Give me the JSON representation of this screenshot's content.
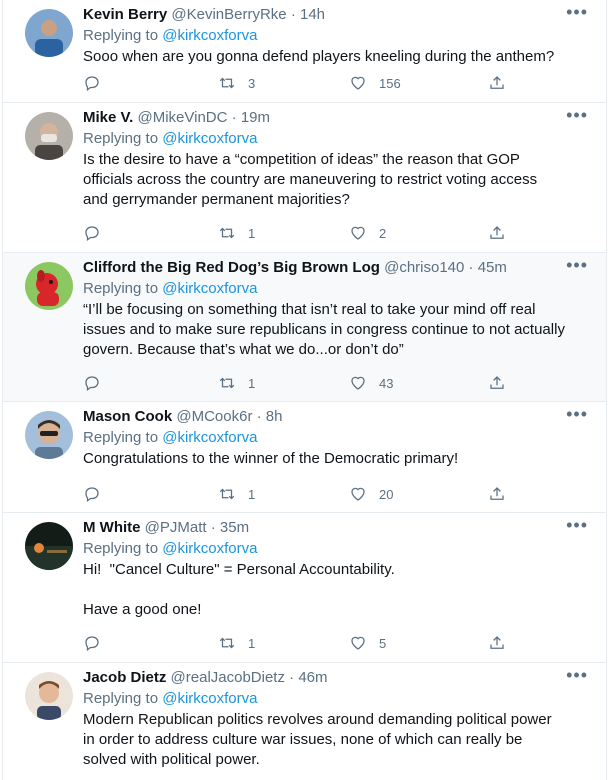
{
  "tweets": [
    {
      "name": "Kevin Berry",
      "handle": "@KevinBerryRke",
      "sep": "·",
      "time": "14h",
      "replying_prefix": "Replying to ",
      "replying_to": "@kirkcoxforva",
      "text": "Sooo when are you gonna defend players kneeling during the anthem?",
      "retweets": "3",
      "likes": "156",
      "avatar_colors": [
        "#6a8fb8",
        "#2c5d8f"
      ],
      "highlighted": false
    },
    {
      "name": "Mike V.",
      "handle": "@MikeVinDC",
      "sep": "·",
      "time": "19m",
      "replying_prefix": "Replying to ",
      "replying_to": "@kirkcoxforva",
      "text": "Is the desire to have a “competition of ideas” the reason that GOP officials across the country are maneuvering to restrict voting access and gerrymander permanent majorities?",
      "retweets": "1",
      "likes": "2",
      "avatar_colors": [
        "#b9b4ad",
        "#5c5650"
      ],
      "highlighted": false
    },
    {
      "name": "Clifford the Big Red Dog’s Big Brown Log",
      "handle": "@chriso140",
      "sep": "·",
      "time": "45m",
      "replying_prefix": "Replying to ",
      "replying_to": "@kirkcoxforva",
      "text": "“I’ll be focusing on something that isn’t real to take your mind off real issues and to make sure republicans in congress continue to not actually govern. Because that’s what we do...or don’t do”",
      "retweets": "1",
      "likes": "43",
      "avatar_colors": [
        "#7fc25a",
        "#d8262a"
      ],
      "highlighted": true
    },
    {
      "name": "Mason Cook",
      "handle": "@MCook6r",
      "sep": "·",
      "time": "8h",
      "replying_prefix": "Replying to ",
      "replying_to": "@kirkcoxforva",
      "text": "Congratulations to the winner of the Democratic primary!",
      "retweets": "1",
      "likes": "20",
      "avatar_colors": [
        "#9cb7d3",
        "#3b3128"
      ],
      "highlighted": false
    },
    {
      "name": "M White",
      "handle": "@PJMatt",
      "sep": "·",
      "time": "35m",
      "replying_prefix": "Replying to ",
      "replying_to": "@kirkcoxforva",
      "text": "Hi!  \"Cancel Culture\" = Personal Accountability.\n\nHave a good one!",
      "retweets": "1",
      "likes": "5",
      "avatar_colors": [
        "#1c2a22",
        "#c8783a"
      ],
      "highlighted": false
    },
    {
      "name": "Jacob Dietz",
      "handle": "@realJacobDietz",
      "sep": "·",
      "time": "46m",
      "replying_prefix": "Replying to ",
      "replying_to": "@kirkcoxforva",
      "text": "Modern Republican politics revolves around demanding political power in order to address culture war issues, none of which can really be solved with political power.",
      "retweets": "",
      "likes": "",
      "avatar_colors": [
        "#e6dcd0",
        "#8a5a3a"
      ],
      "highlighted": false
    }
  ],
  "icons": {
    "more": "more-icon",
    "reply": "reply-icon",
    "retweet": "retweet-icon",
    "like": "heart-icon",
    "share": "share-icon"
  },
  "colors": {
    "link": "#1b95e0",
    "muted": "#5b7083",
    "divider": "#e6ecf0",
    "highlight_bg": "#f7f9fa"
  }
}
